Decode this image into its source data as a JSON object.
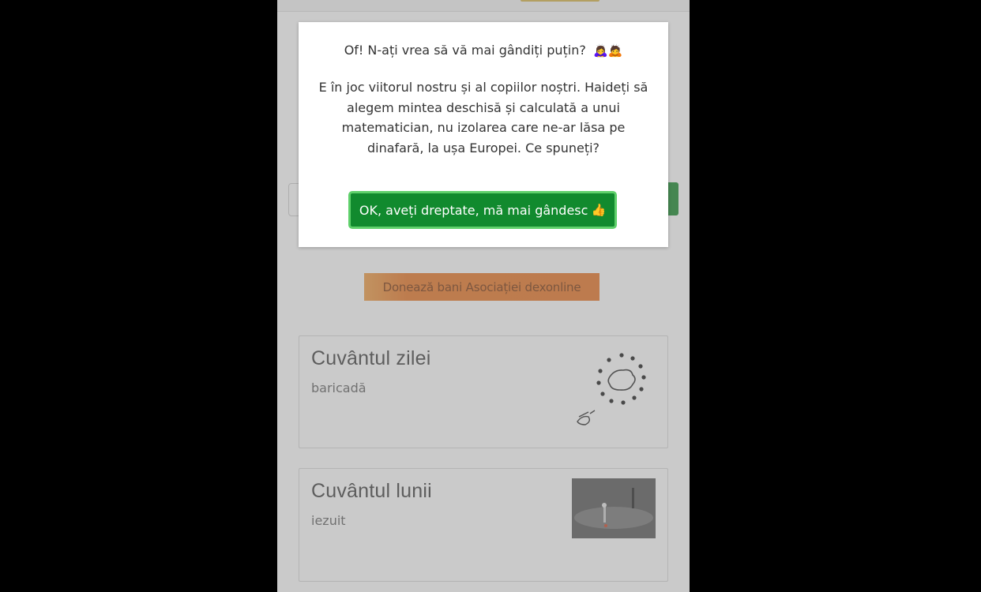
{
  "modal": {
    "title": "Of! N-ați vrea să vă mai gândiți puțin?",
    "title_emoji": "🙇‍♀️🙇",
    "message": "E în joc viitorul nostru și al copiilor noștri. Haideți să alegem mintea deschisă și calculată a unui matematician, nu izolarea care ne-ar lăsa pe dinafară, la ușa Europei. Ce spuneți?",
    "confirm_label": "OK, aveți dreptate, mă mai gândesc",
    "confirm_emoji": "👍"
  },
  "donate": {
    "label": "Donează bani Asociației dexonline"
  },
  "cards": {
    "word_of_day": {
      "title": "Cuvântul zilei",
      "word": "baricadă",
      "image_icon": "eu-stars-romania-map-icon"
    },
    "word_of_month": {
      "title": "Cuvântul lunii",
      "word": "iezuit",
      "image_icon": "photo-thumbnail"
    }
  },
  "colors": {
    "button_green": "#118a2e",
    "donate_orange": "#e8782a",
    "backdrop": "#000000"
  }
}
